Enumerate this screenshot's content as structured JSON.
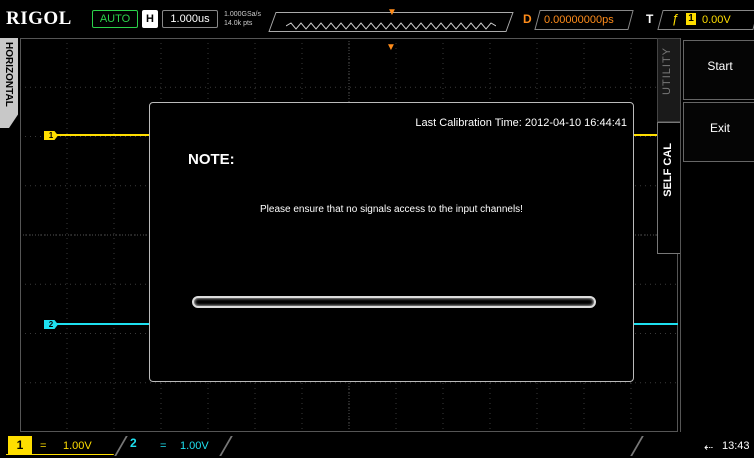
{
  "header": {
    "logo": "RIGOL",
    "run_state": "AUTO",
    "h_label": "H",
    "timebase": "1.000us",
    "sample_rate": "1.000GSa/s",
    "memory_depth": "14.0k pts",
    "d_label": "D",
    "delay": "0.00000000ps",
    "t_label": "T",
    "trigger_channel": "1",
    "trigger_level": "0.00V"
  },
  "left_tab": {
    "label": "HORIZONTAL"
  },
  "channels": [
    {
      "number": "1",
      "coupling": "=",
      "scale": "1.00V",
      "color": "#ffde00"
    },
    {
      "number": "2",
      "coupling": "=",
      "scale": "1.00V",
      "color": "#1ee0f0"
    }
  ],
  "dialog": {
    "calibration_time": "Last Calibration Time: 2012-04-10 16:44:41",
    "title": "NOTE:",
    "message": "Please ensure that no signals access to the input channels!"
  },
  "menu": {
    "tab_utility": "UTILITY",
    "tab_selfcal": "SELF CAL",
    "start_label": "Start",
    "exit_label": "Exit"
  },
  "status": {
    "usb_icon": "usb-icon",
    "time": "13:43"
  },
  "colors": {
    "ch1": "#ffde00",
    "ch2": "#1ee0f0",
    "trigger": "#ff8c1a",
    "run": "#2bd14a"
  }
}
